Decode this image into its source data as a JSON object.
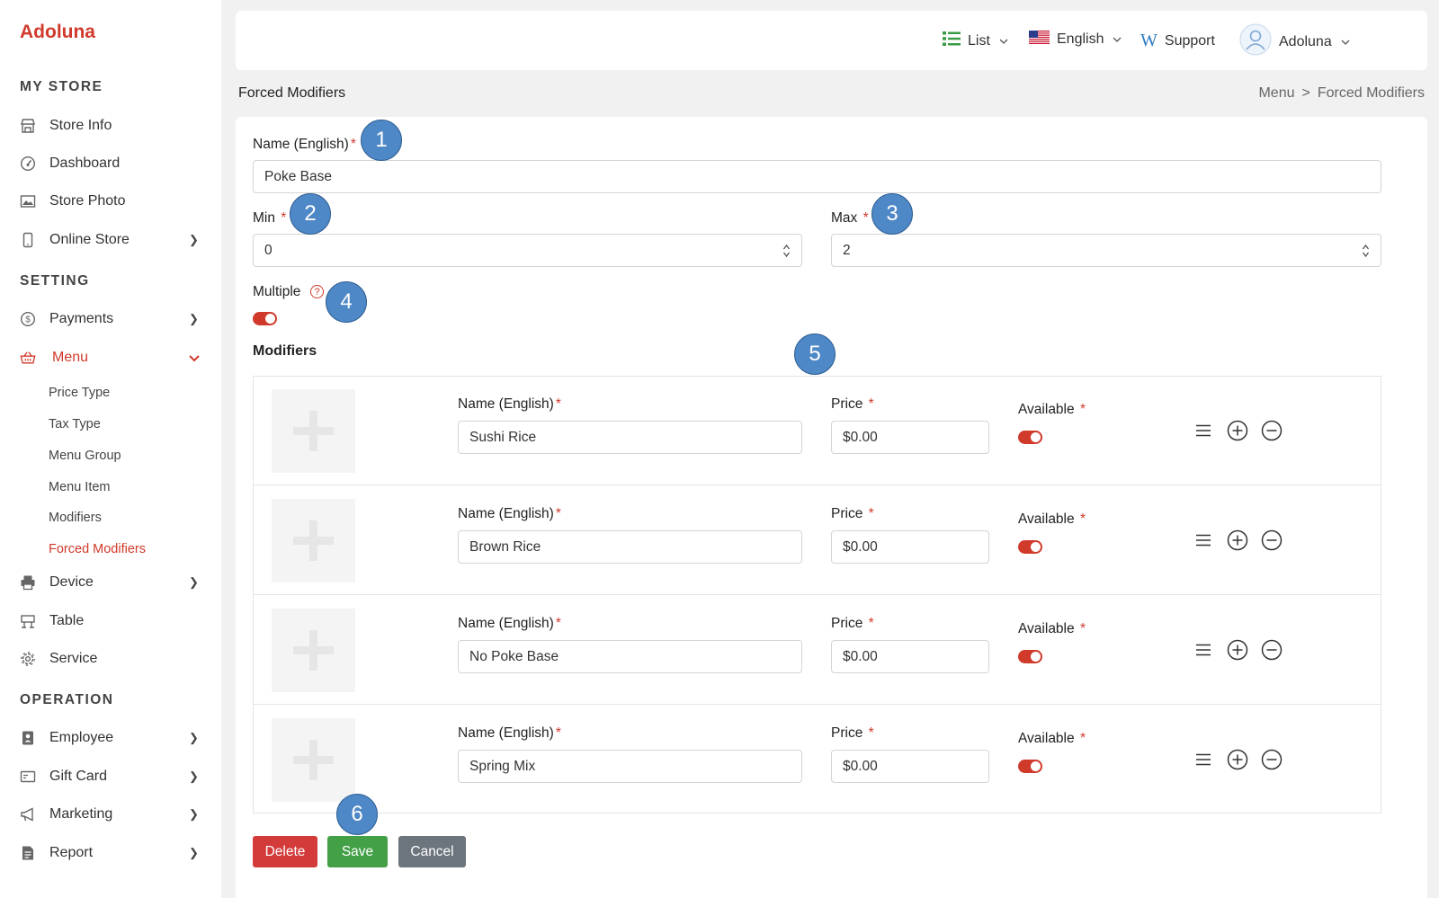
{
  "sidebar": {
    "logo": "Adoluna",
    "sections": {
      "my_store": "MY STORE",
      "setting": "SETTING",
      "operation": "OPERATION"
    },
    "items": {
      "store_info": "Store Info",
      "dashboard": "Dashboard",
      "store_photo": "Store Photo",
      "online_store": "Online Store",
      "payments": "Payments",
      "menu": "Menu",
      "device": "Device",
      "table": "Table",
      "service": "Service",
      "employee": "Employee",
      "gift_card": "Gift Card",
      "marketing": "Marketing",
      "report": "Report"
    },
    "menu_sub": {
      "price_type": "Price Type",
      "tax_type": "Tax Type",
      "menu_group": "Menu Group",
      "menu_item": "Menu Item",
      "modifiers": "Modifiers",
      "forced_modifiers": "Forced Modifiers"
    }
  },
  "topbar": {
    "list": "List",
    "language": "English",
    "support": "Support",
    "user": "Adoluna"
  },
  "page": {
    "title": "Forced Modifiers",
    "breadcrumb": [
      "Menu",
      ">",
      "Forced Modifiers"
    ]
  },
  "form": {
    "name_label": "Name (English)",
    "name_value": "Poke Base",
    "min_label": "Min",
    "min_value": "0",
    "max_label": "Max",
    "max_value": "2",
    "multiple_label": "Multiple",
    "multiple_on": true,
    "required_mark": "*",
    "help_mark": "?"
  },
  "modifiers": {
    "title": "Modifiers",
    "col_name": "Name (English)",
    "col_price": "Price",
    "col_available": "Available",
    "rows": [
      {
        "name": "Sushi Rice",
        "price": "$0.00",
        "available": true
      },
      {
        "name": "Brown Rice",
        "price": "$0.00",
        "available": true
      },
      {
        "name": "No Poke Base",
        "price": "$0.00",
        "available": true
      },
      {
        "name": "Spring Mix",
        "price": "$0.00",
        "available": true
      }
    ]
  },
  "buttons": {
    "delete": "Delete",
    "save": "Save",
    "cancel": "Cancel"
  },
  "badges": [
    "1",
    "2",
    "3",
    "4",
    "5",
    "6"
  ],
  "colors": {
    "accent": "#d03a2b",
    "save": "#43a047",
    "delete": "#d33a3a",
    "cancel": "#6c757d",
    "badge": "#4f88c6"
  }
}
